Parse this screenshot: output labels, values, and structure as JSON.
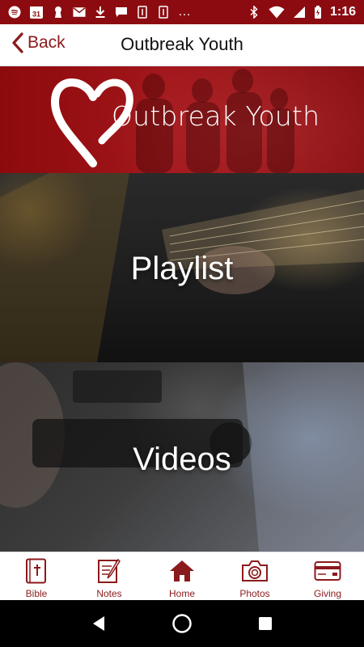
{
  "status_bar": {
    "time": "1:16",
    "calendar_day": "31",
    "left_icons": [
      "spotify-icon",
      "calendar-icon",
      "keyhole-icon",
      "gmail-icon",
      "download-icon",
      "message-icon",
      "sim-icon",
      "sim-icon"
    ],
    "right_icons": [
      "bluetooth-icon",
      "wifi-icon",
      "signal-icon",
      "battery-icon"
    ],
    "more": "…"
  },
  "header": {
    "back_label": "Back",
    "title": "Outbreak Youth"
  },
  "banner": {
    "title": "Outbreak Youth"
  },
  "tiles": [
    {
      "label": "Playlist"
    },
    {
      "label": "Videos"
    }
  ],
  "tab_bar": {
    "items": [
      {
        "label": "Bible",
        "icon": "bible-icon"
      },
      {
        "label": "Notes",
        "icon": "notes-icon"
      },
      {
        "label": "Home",
        "icon": "home-icon"
      },
      {
        "label": "Photos",
        "icon": "camera-icon"
      },
      {
        "label": "Giving",
        "icon": "credit-card-icon"
      }
    ]
  },
  "colors": {
    "brand": "#8b1a1d",
    "status_bar": "#8b0b10",
    "banner": "#a1161a"
  }
}
